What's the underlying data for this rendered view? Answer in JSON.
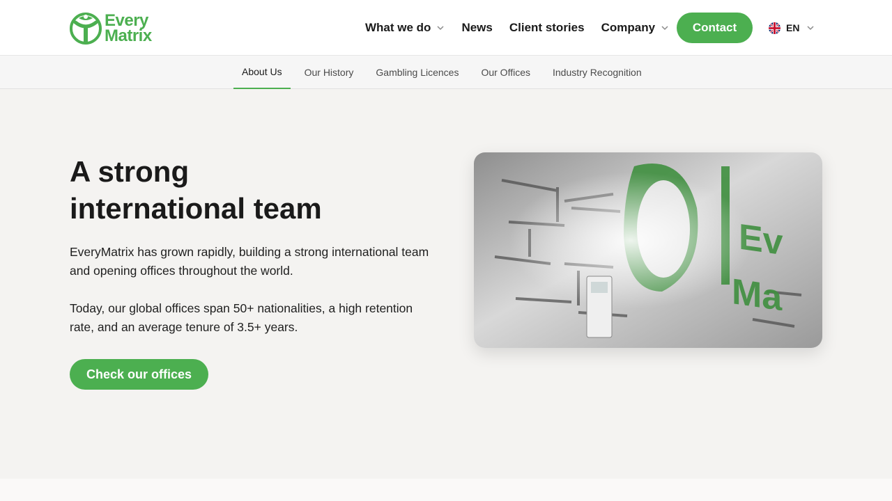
{
  "brand": {
    "name_line1": "Every",
    "name_line2": "Matrix",
    "color": "#4caf50",
    "logo_icon": "everymatrix-logo-icon"
  },
  "header": {
    "nav": [
      {
        "label": "What we do",
        "has_dropdown": true
      },
      {
        "label": "News",
        "has_dropdown": false
      },
      {
        "label": "Client stories",
        "has_dropdown": false
      },
      {
        "label": "Company",
        "has_dropdown": true
      }
    ],
    "contact_label": "Contact",
    "language": {
      "code": "EN",
      "flag_icon": "uk-flag-icon"
    }
  },
  "subnav": {
    "items": [
      {
        "label": "About Us",
        "active": true
      },
      {
        "label": "Our History",
        "active": false
      },
      {
        "label": "Gambling Licences",
        "active": false
      },
      {
        "label": "Our Offices",
        "active": false
      },
      {
        "label": "Industry Recognition",
        "active": false
      }
    ]
  },
  "hero": {
    "title_line1": "A strong",
    "title_line2": "international team",
    "paragraph1": "EveryMatrix has grown rapidly, building a strong international team and opening offices throughout the world.",
    "paragraph2": "Today, our global offices span 50+ nationalities, a high retention rate, and an average tenure of 3.5+ years.",
    "cta_label": "Check our offices"
  },
  "colors": {
    "accent": "#4caf50",
    "background": "#f4f3f1",
    "text": "#1a1a1a"
  }
}
